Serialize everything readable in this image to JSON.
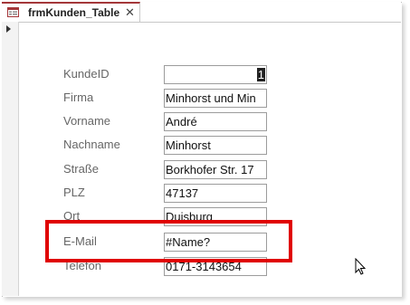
{
  "tab": {
    "title": "frmKunden_Table",
    "close": "✕"
  },
  "fields": [
    {
      "label": "KundeID",
      "value": "1"
    },
    {
      "label": "Firma",
      "value": "Minhorst und Min"
    },
    {
      "label": "Vorname",
      "value": "André"
    },
    {
      "label": "Nachname",
      "value": "Minhorst"
    },
    {
      "label": "Straße",
      "value": "Borkhofer Str. 17"
    },
    {
      "label": "PLZ",
      "value": "47137"
    },
    {
      "label": "Ort",
      "value": "Duisburg"
    },
    {
      "label": "E-Mail",
      "value": "#Name?"
    },
    {
      "label": "Telefon",
      "value": "0171-3143654"
    }
  ],
  "colors": {
    "highlight": "#e00000",
    "tab_accent": "#a4373a"
  },
  "icons": {
    "tab": "form-icon",
    "selector": "record-selector-arrow-icon",
    "pointer": "mouse-pointer-icon"
  }
}
